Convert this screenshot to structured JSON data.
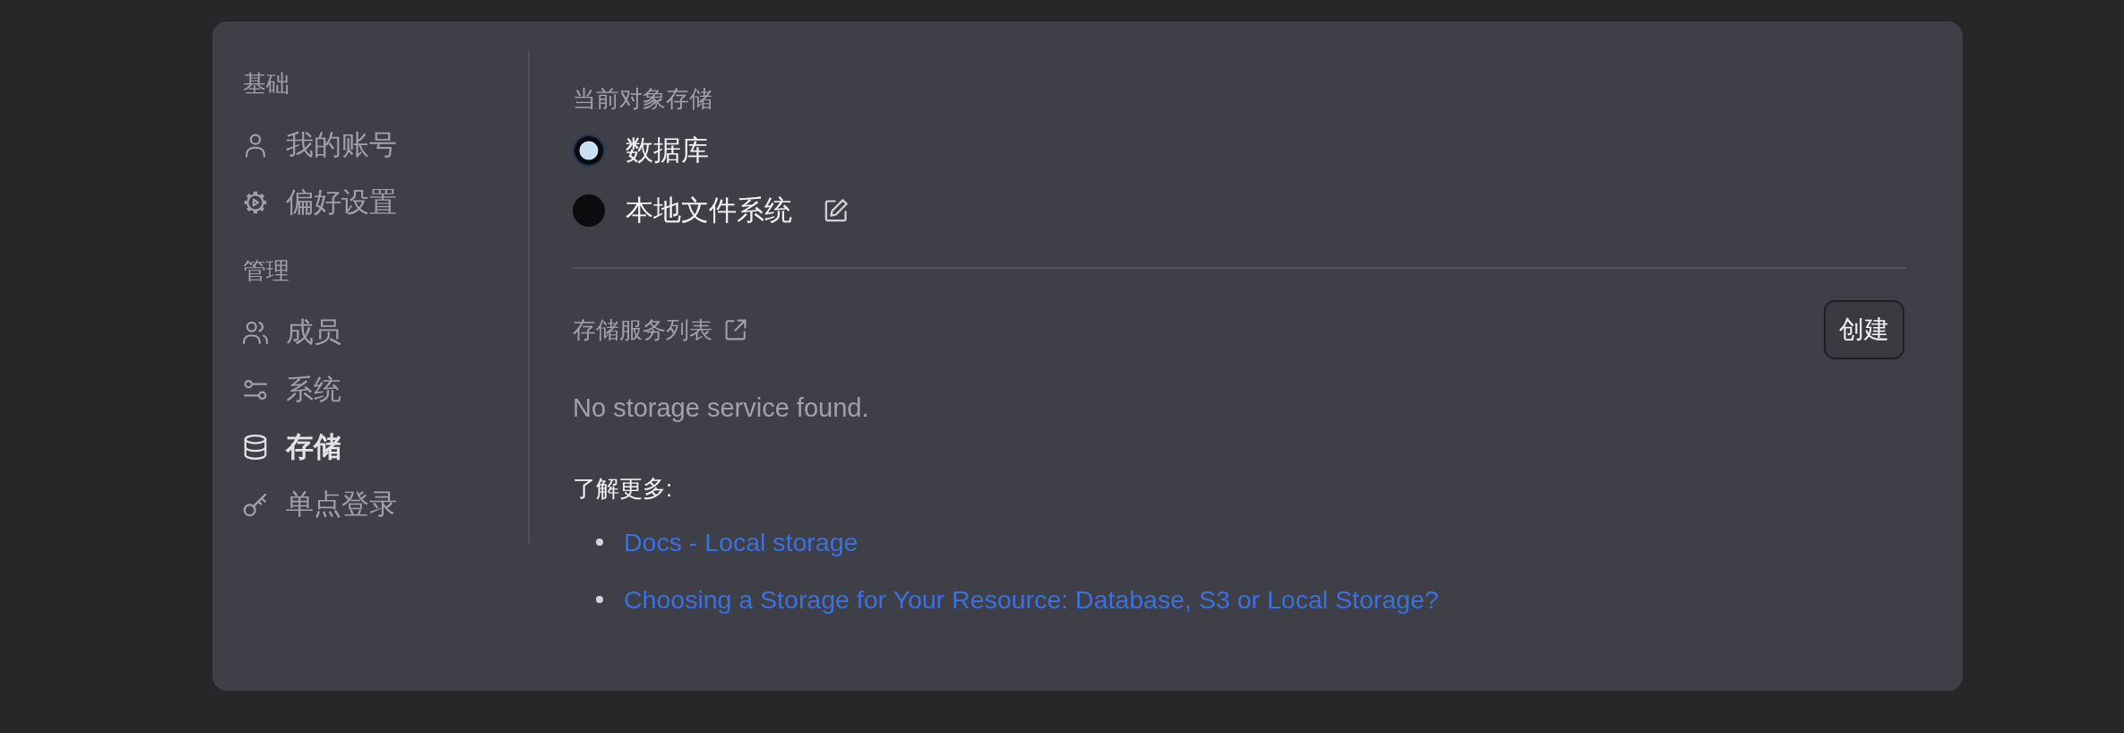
{
  "sidebar": {
    "sections": [
      {
        "title": "基础",
        "items": [
          {
            "label": "我的账号",
            "selected": false
          },
          {
            "label": "偏好设置",
            "selected": false
          }
        ]
      },
      {
        "title": "管理",
        "items": [
          {
            "label": "成员",
            "selected": false
          },
          {
            "label": "系统",
            "selected": false
          },
          {
            "label": "存储",
            "selected": true
          },
          {
            "label": "单点登录",
            "selected": false
          }
        ]
      }
    ]
  },
  "object_storage": {
    "title": "当前对象存储",
    "options": [
      {
        "label": "数据库",
        "selected": true,
        "editable": false
      },
      {
        "label": "本地文件系统",
        "selected": false,
        "editable": true
      }
    ]
  },
  "storage_services": {
    "title": "存储服务列表",
    "create_button": "创建",
    "empty_message": "No storage service found."
  },
  "learn_more": {
    "title": "了解更多:",
    "links": [
      "Docs - Local storage",
      "Choosing a Storage for Your Resource: Database, S3 or Local Storage?"
    ]
  }
}
